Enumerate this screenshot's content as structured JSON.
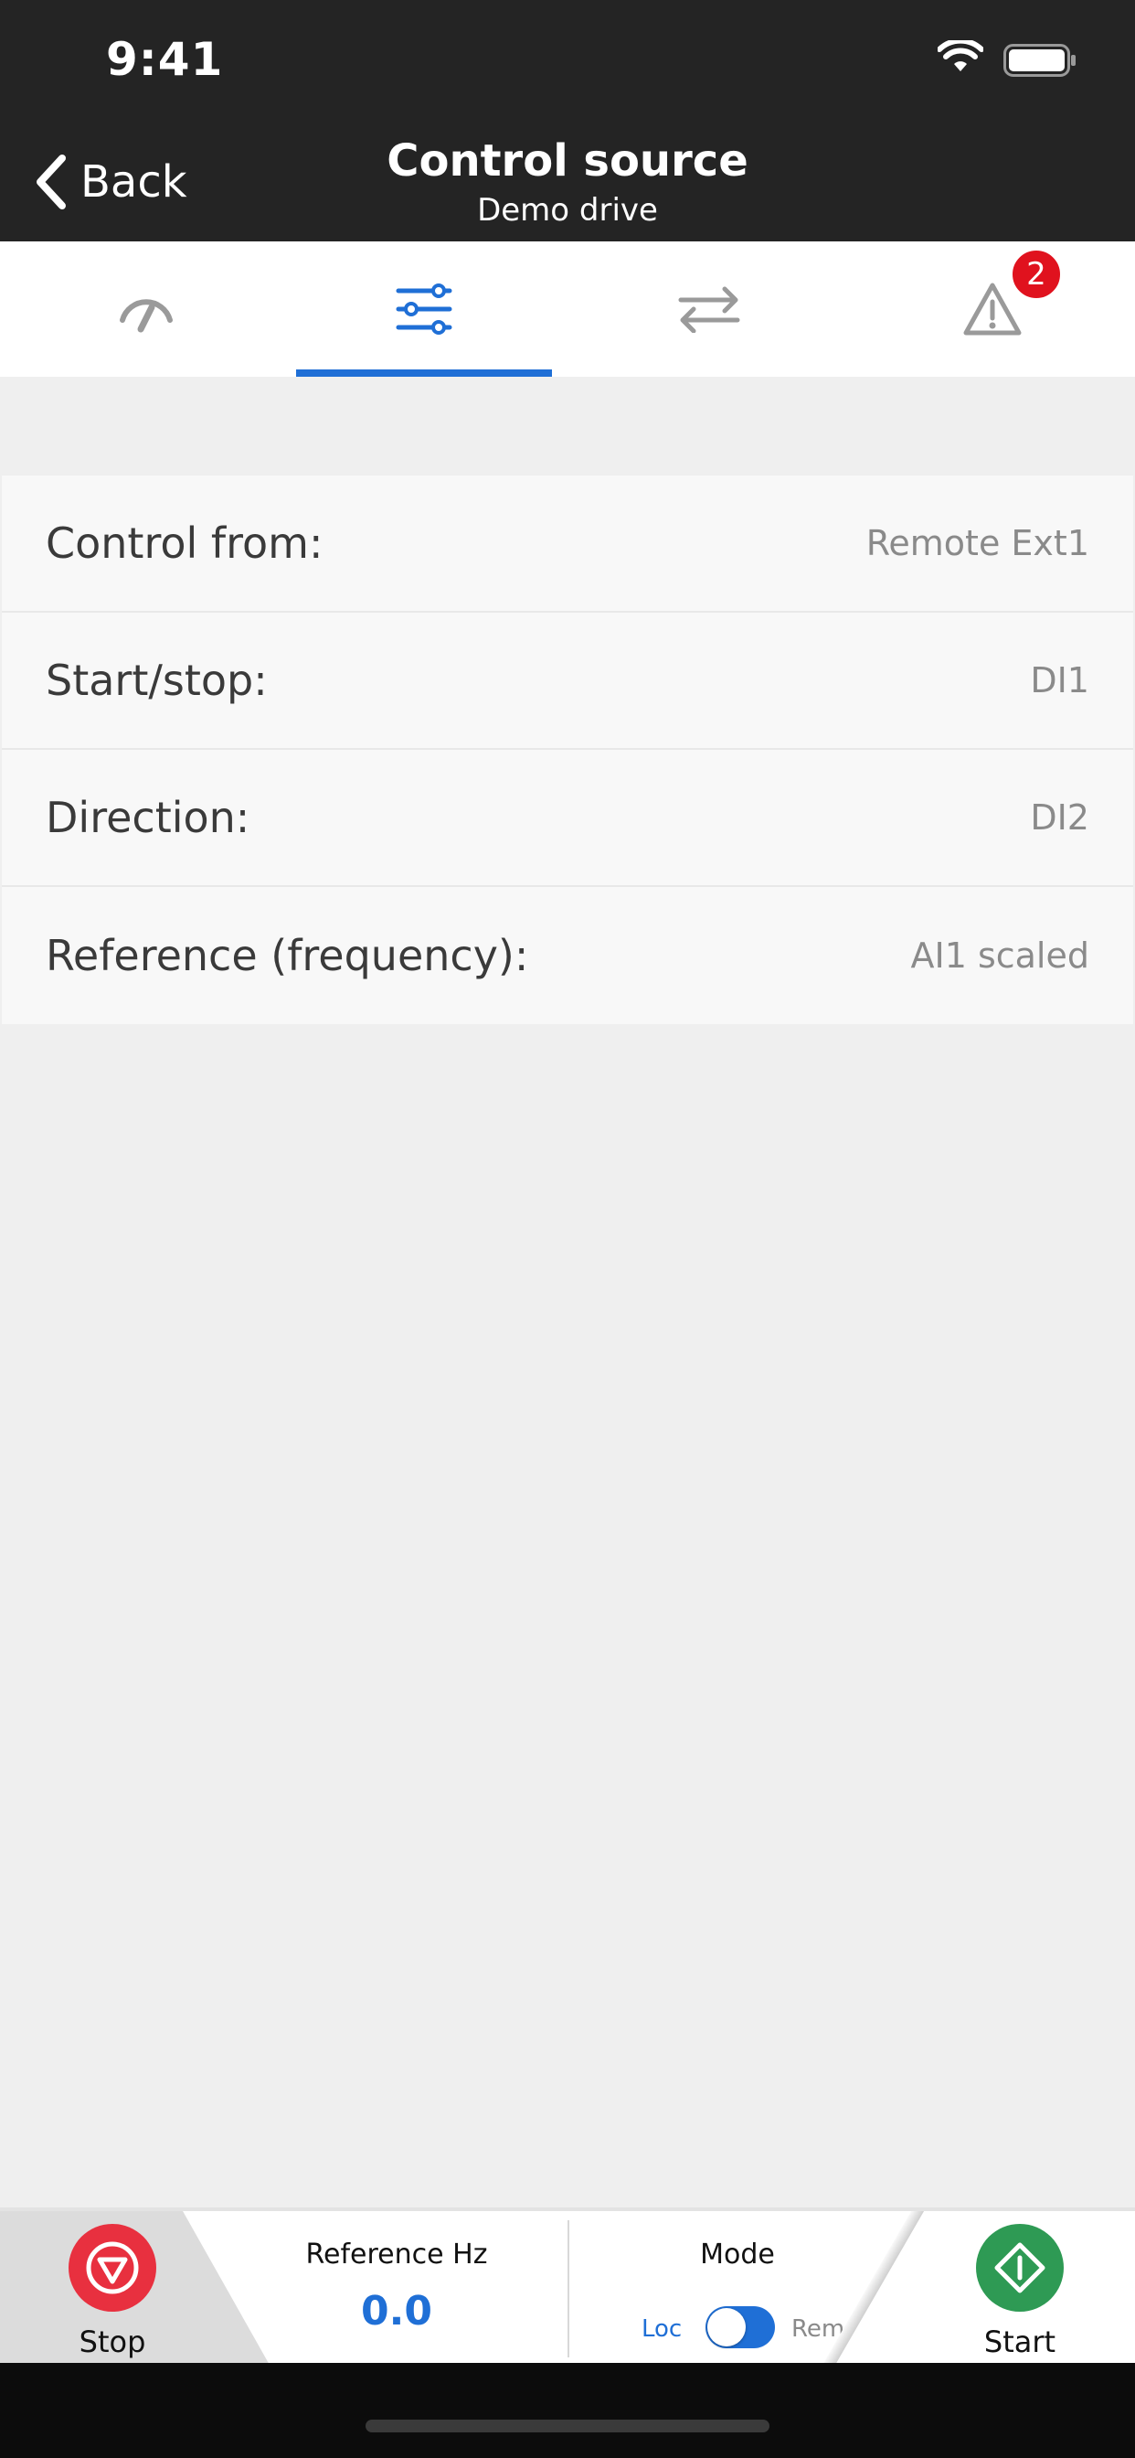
{
  "status_bar": {
    "time": "9:41"
  },
  "header": {
    "back_label": "Back",
    "title": "Control source",
    "subtitle": "Demo drive"
  },
  "tabs": [
    {
      "icon": "gauge-icon",
      "active": false
    },
    {
      "icon": "sliders-icon",
      "active": true
    },
    {
      "icon": "swap-arrows-icon",
      "active": false
    },
    {
      "icon": "warning-icon",
      "active": false,
      "badge": "2"
    }
  ],
  "settings": [
    {
      "label": "Control from:",
      "value": "Remote Ext1"
    },
    {
      "label": "Start/stop:",
      "value": "DI1"
    },
    {
      "label": "Direction:",
      "value": "DI2"
    },
    {
      "label": "Reference (frequency):",
      "value": "AI1 scaled"
    }
  ],
  "bottom_bar": {
    "stop_label": "Stop",
    "reference_title": "Reference Hz",
    "reference_value": "0.0",
    "mode_title": "Mode",
    "mode_local": "Loc",
    "mode_remote": "Rem",
    "start_label": "Start"
  },
  "colors": {
    "accent": "#1f6fd6",
    "header_bg": "#242424",
    "stop": "#e8303f",
    "start": "#2e9a54",
    "badge": "#e0121e"
  }
}
